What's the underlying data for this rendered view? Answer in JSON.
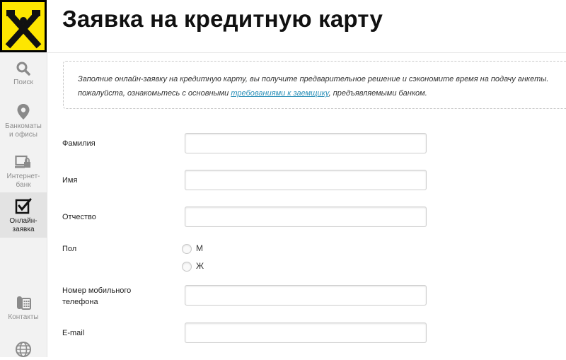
{
  "header": {
    "title": "Заявка на кредитную карту"
  },
  "sidebar": {
    "items": [
      {
        "label": "Поиск",
        "icon": "search-icon"
      },
      {
        "label": "Банкоматы и офисы",
        "icon": "map-pin-icon"
      },
      {
        "label": "Интернет-банк",
        "icon": "internet-bank-icon"
      },
      {
        "label": "Онлайн-заявка",
        "icon": "checkbox-icon"
      },
      {
        "label": "Контакты",
        "icon": "phone-icon"
      },
      {
        "label": "",
        "icon": "globe-icon"
      }
    ]
  },
  "intro": {
    "text_before": "Заполние онлайн-заявку на кредитную карту, вы получите предварительное решение и сэкономите время на подачу анкеты.",
    "text_line2_before": "пожалуйста, ознакомьтесь с основными ",
    "link": "требованиями к заемщику",
    "text_line2_after": ", предъявляемыми банком."
  },
  "form": {
    "surname_label": "Фамилия",
    "name_label": "Имя",
    "patronymic_label": "Отчество",
    "gender_label": "Пол",
    "gender_options": [
      "М",
      "Ж"
    ],
    "phone_label": "Номер мобильного телефона",
    "email_label": "E-mail",
    "surname_value": "",
    "name_value": "",
    "patronymic_value": "",
    "phone_value": "",
    "email_value": ""
  },
  "colors": {
    "brand_yellow": "#fee600",
    "link_blue": "#2a8fb8",
    "sidebar_bg": "#f2f2f2"
  }
}
